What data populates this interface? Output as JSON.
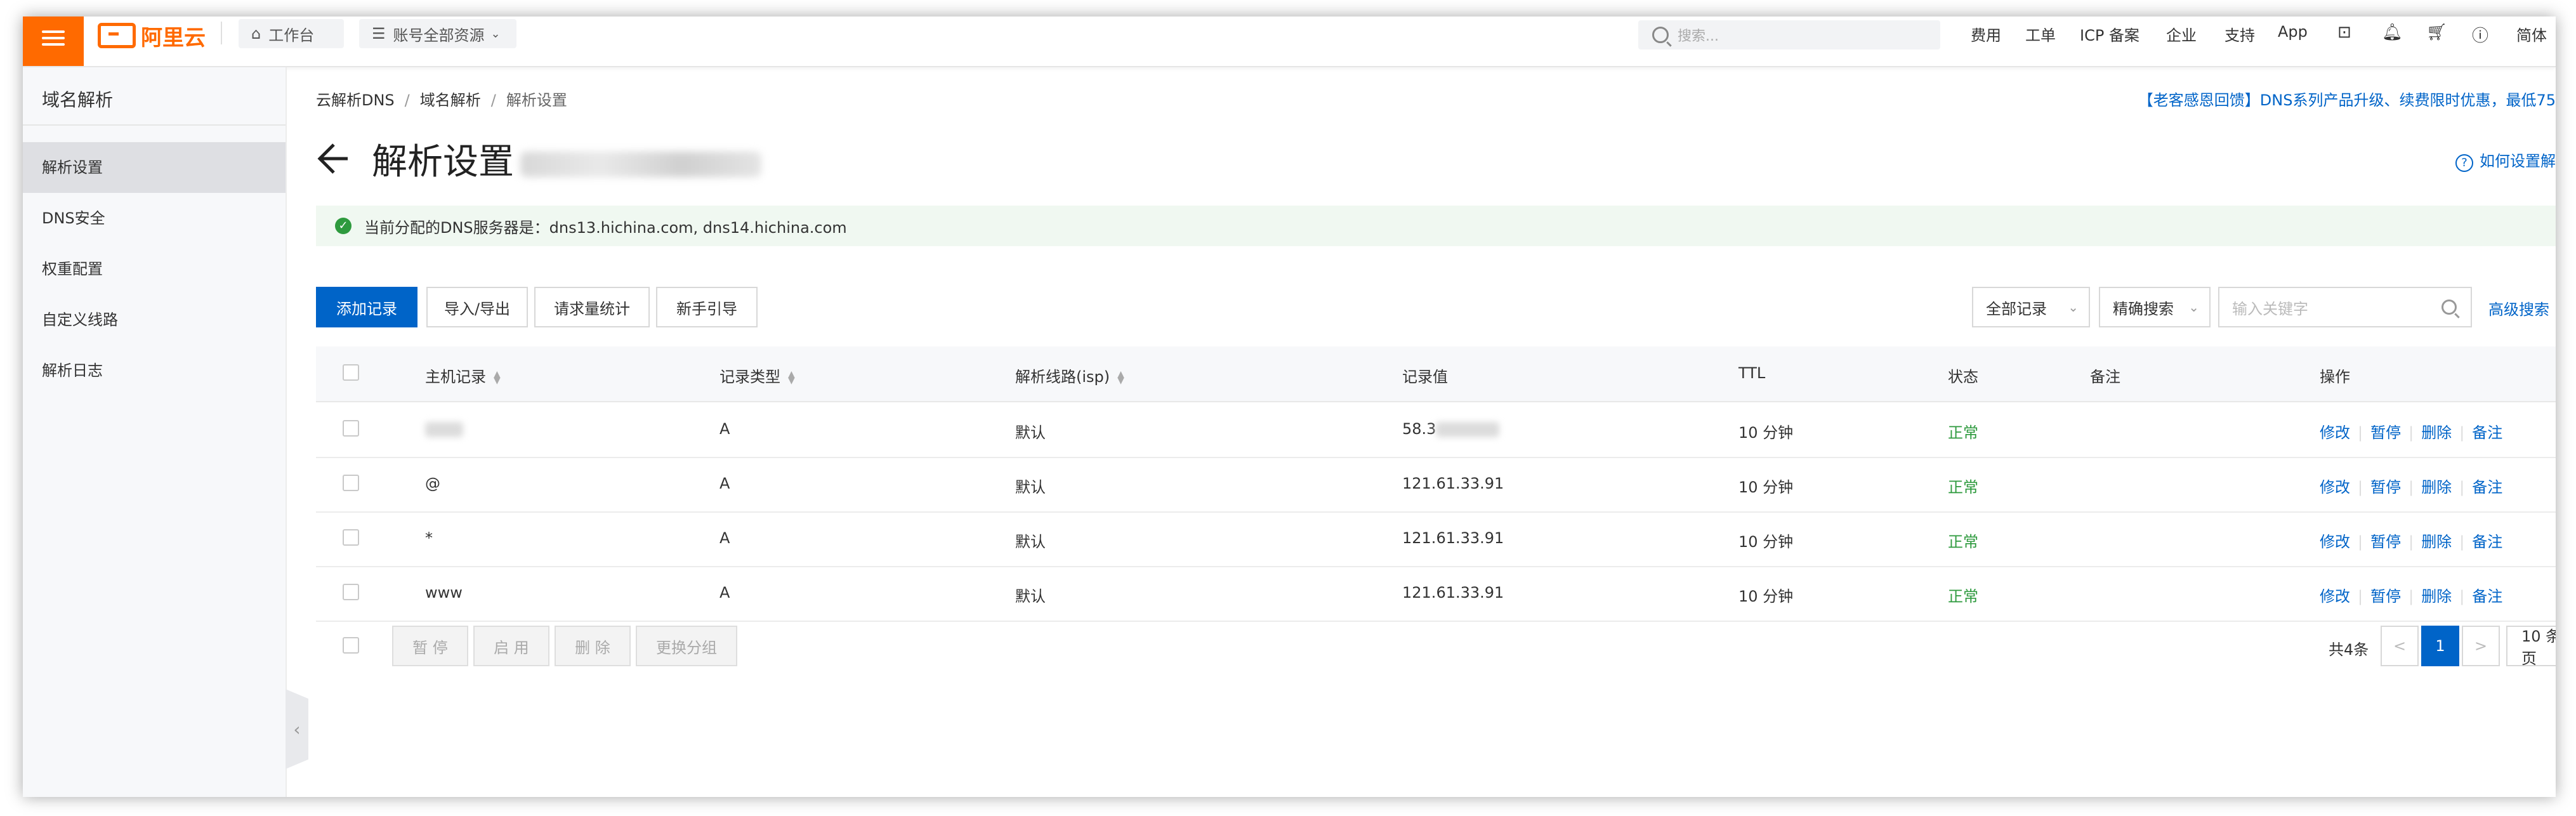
{
  "topbar": {
    "logo_text": "阿里云",
    "workbench": "工作台",
    "resources": "账号全部资源",
    "search_placeholder": "搜索...",
    "links": [
      "费用",
      "工单",
      "ICP 备案",
      "企业",
      "支持",
      "App"
    ],
    "lang": "简体"
  },
  "sidebar": {
    "title": "域名解析",
    "items": [
      {
        "label": "解析设置"
      },
      {
        "label": "DNS安全"
      },
      {
        "label": "权重配置"
      },
      {
        "label": "自定义线路"
      },
      {
        "label": "解析日志"
      }
    ]
  },
  "breadcrumb": [
    "云解析DNS",
    "域名解析",
    "解析设置"
  ],
  "promo": "【老客感恩回馈】DNS系列产品升级、续费限时优惠，最低75",
  "page_title": "解析设置",
  "howto": "如何设置解",
  "alert": "当前分配的DNS服务器是：dns13.hichina.com, dns14.hichina.com",
  "toolbar": {
    "add": "添加记录",
    "import_export": "导入/导出",
    "stats": "请求量统计",
    "guide": "新手引导",
    "filter": "全部记录",
    "search_mode": "精确搜索",
    "keyword_placeholder": "输入关键字",
    "advanced": "高级搜索"
  },
  "table": {
    "columns": [
      "主机记录",
      "记录类型",
      "解析线路(isp)",
      "记录值",
      "TTL",
      "状态",
      "备注",
      "操作"
    ],
    "rows": [
      {
        "host": "",
        "type": "A",
        "line": "默认",
        "value": "58.3",
        "ttl": "10 分钟",
        "status": "正常",
        "note": ""
      },
      {
        "host": "@",
        "type": "A",
        "line": "默认",
        "value": "121.61.33.91",
        "ttl": "10 分钟",
        "status": "正常",
        "note": ""
      },
      {
        "host": "*",
        "type": "A",
        "line": "默认",
        "value": "121.61.33.91",
        "ttl": "10 分钟",
        "status": "正常",
        "note": ""
      },
      {
        "host": "www",
        "type": "A",
        "line": "默认",
        "value": "121.61.33.91",
        "ttl": "10 分钟",
        "status": "正常",
        "note": ""
      }
    ],
    "actions": [
      "修改",
      "暂停",
      "删除",
      "备注"
    ]
  },
  "footer": {
    "bulk": [
      "暂 停",
      "启 用",
      "删 除",
      "更换分组"
    ],
    "total": "共4条",
    "prev": "<",
    "page": "1",
    "next": ">",
    "page_size": "10 条/页"
  }
}
